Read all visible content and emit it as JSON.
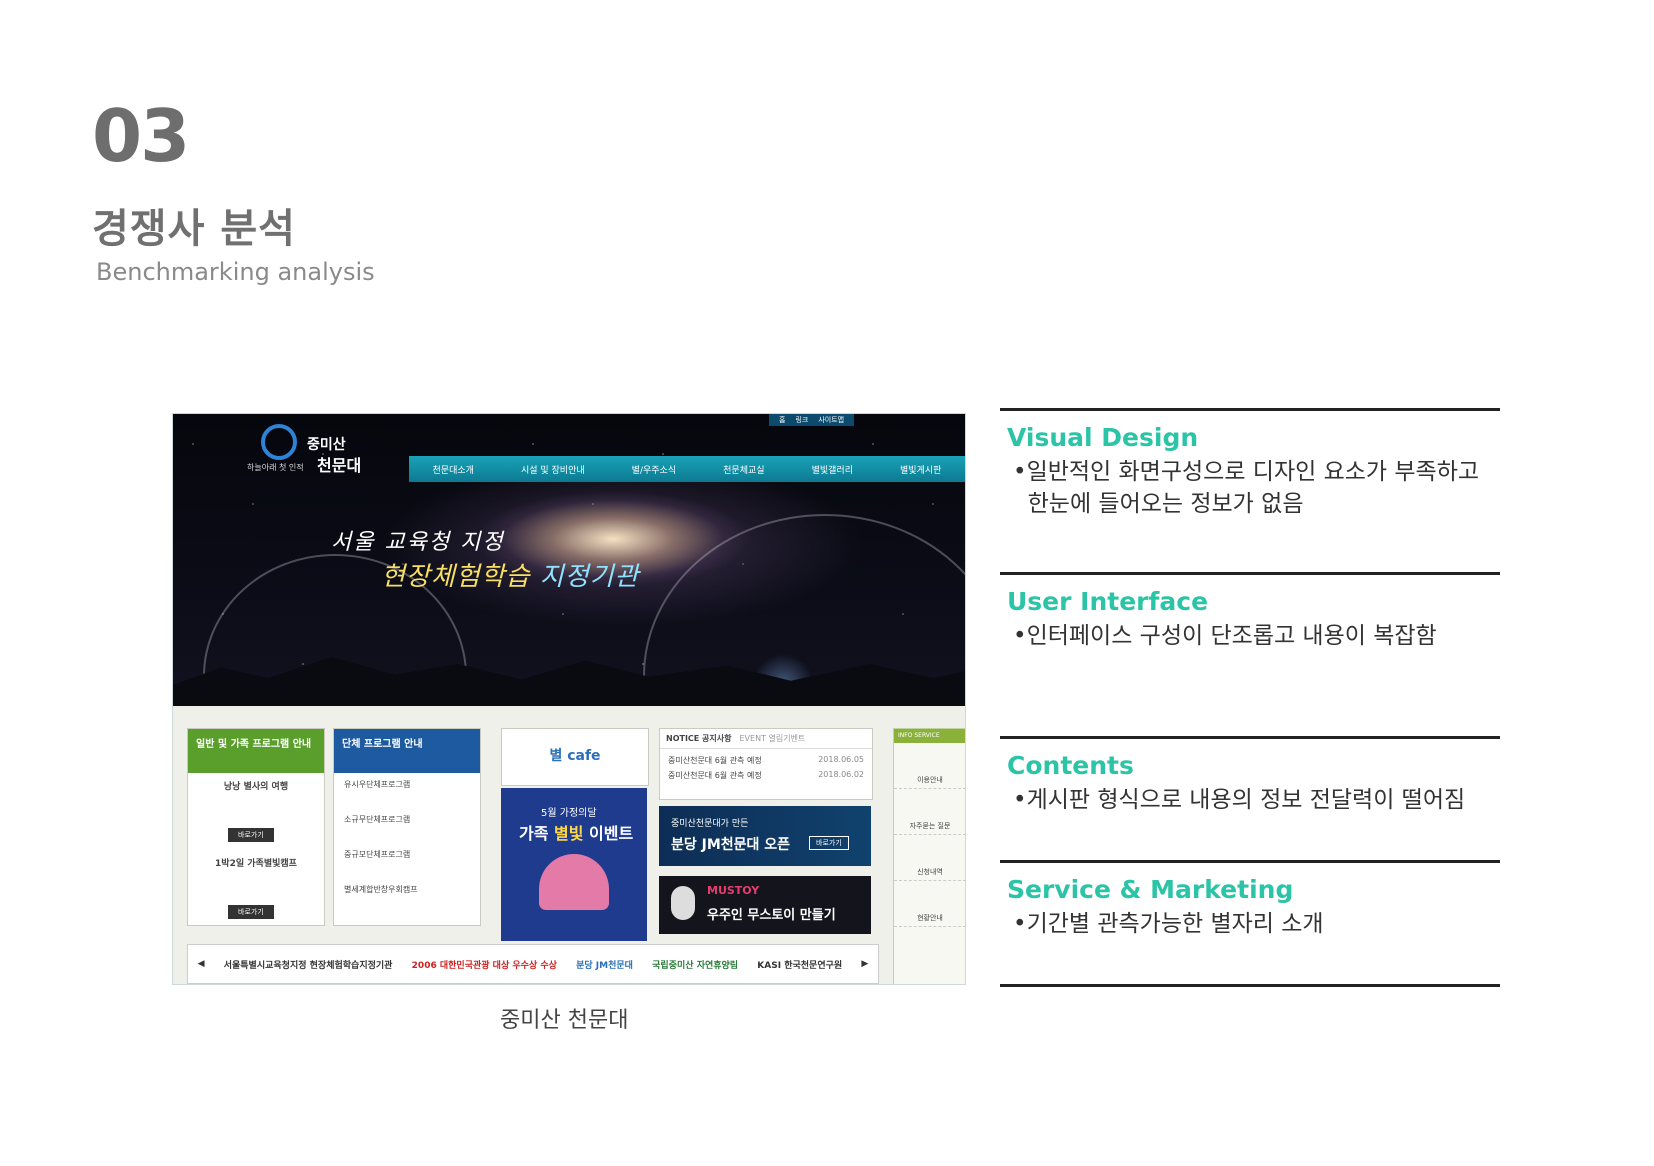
{
  "header": {
    "number": "03",
    "title_ko": "경쟁사 분석",
    "title_en": "Benchmarking analysis"
  },
  "screenshot": {
    "caption": "중미산 천문대",
    "logo_title": "중미산",
    "logo_title2": "천문대",
    "logo_subtitle": "하늘아래 첫 인적",
    "top_links": [
      "홈",
      "링크",
      "사이트맵"
    ],
    "main_nav": [
      "천문대소개",
      "시설 및 장비안내",
      "별/우주소식",
      "천문체교실",
      "별빛갤러리",
      "별빛게시판"
    ],
    "hero_line1": "서울 교육청 지정",
    "hero_line2_a": "현장체험학습",
    "hero_line2_b": " 지정기관",
    "box1": {
      "head": "일반 및 가족 프로그램 안내",
      "item1": "낭낭 별사의 여행",
      "item1_btn": "바로가기",
      "item2": "1박2일 가족별빛캠프",
      "item2_btn": "바로가기"
    },
    "box2": {
      "head": "단체 프로그램 안내",
      "items": [
        "유시우단체프로그램",
        "소규무단체프로그램",
        "중규모단체프로그램",
        "별세계합반창우회캠프"
      ]
    },
    "notice": {
      "tab1": "NOTICE 공지사항",
      "tab2": "EVENT 열림기벤트",
      "rows": [
        {
          "text": "중미산천문대 6월 관측 예정",
          "date": "2018.06.05"
        },
        {
          "text": "중미산천문대 6월 관측 예정",
          "date": "2018.06.02"
        }
      ]
    },
    "cafe_label": "별 cafe",
    "event_line1": "5월 가정의달",
    "event_line2_a": "가족 ",
    "event_line2_b": "별빛",
    "event_line2_c": " 이벤트",
    "card1_line1": "중미산천문대가 만든",
    "card1_line2": "분당 JM천문대 오픈",
    "card1_btn": "바로가기",
    "card2_brand": "MUSTOY",
    "card2_line": "우주인 무스토이 만들기",
    "side_head": "INFO SERVICE",
    "side_items": [
      "이용안내",
      "자주묻는 질문",
      "신청내역",
      "현황안내"
    ],
    "banners": [
      "서울특별시교육청지정 현장체험학습지정기관",
      "2006 대한민국관광 대상 우수상 수상",
      "분당 JM천문대",
      "국립중미산 자연휴양림",
      "KASI 한국천문연구원"
    ]
  },
  "sections": [
    {
      "title": "Visual Design",
      "lines": [
        "•일반적인 화면구성으로 디자인 요소가 부족하고",
        "  한눈에 들어오는 정보가 없음"
      ]
    },
    {
      "title": "User Interface",
      "lines": [
        "•인터페이스 구성이 단조롭고 내용이 복잡함"
      ]
    },
    {
      "title": "Contents",
      "lines": [
        "•게시판 형식으로 내용의 정보 전달력이 떨어짐"
      ]
    },
    {
      "title": "Service & Marketing",
      "lines": [
        "•기간별 관측가능한 별자리 소개"
      ]
    }
  ],
  "colors": {
    "accent": "#2bc4a6",
    "heading_gray": "#707070"
  }
}
